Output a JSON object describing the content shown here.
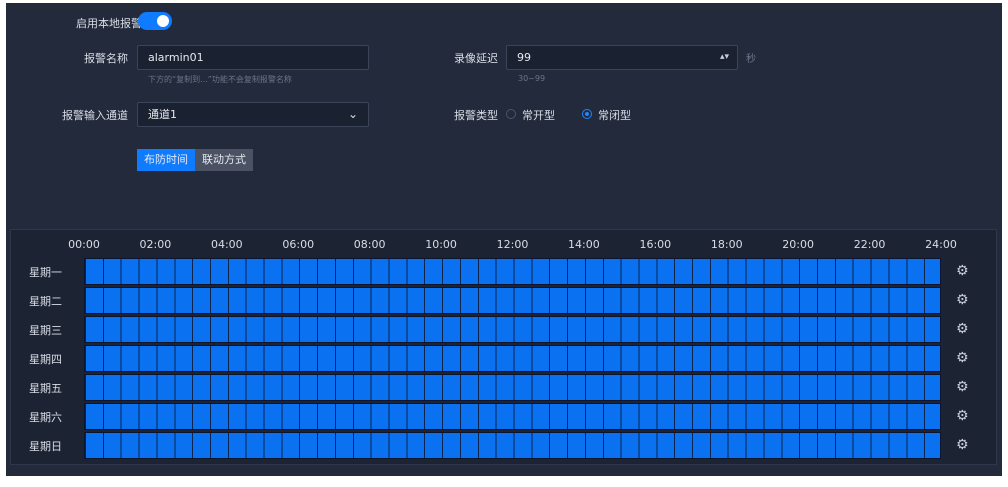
{
  "form": {
    "enable_label": "启用本地报警",
    "name_label": "报警名称",
    "name_value": "alarmin01",
    "name_hint": "下方的“复制到...”功能不会复制报警名称",
    "delay_label": "录像延迟",
    "delay_value": "99",
    "delay_unit": "秒",
    "delay_hint": "30~99",
    "input_channel_label": "报警输入通道",
    "input_channel_value": "通道1",
    "alarm_type_label": "报警类型",
    "alarm_type_options": [
      "常开型",
      "常闭型"
    ],
    "alarm_type_selected": "常闭型"
  },
  "tabs": [
    "布防时间",
    "联动方式"
  ],
  "schedule": {
    "time_labels": [
      "00:00",
      "02:00",
      "04:00",
      "06:00",
      "08:00",
      "10:00",
      "12:00",
      "14:00",
      "16:00",
      "18:00",
      "20:00",
      "22:00",
      "24:00"
    ],
    "days": [
      "星期一",
      "星期二",
      "星期三",
      "星期四",
      "星期五",
      "星期六",
      "星期日"
    ]
  },
  "colors": {
    "accent": "#0f7bff",
    "panel_bg": "#222a3b",
    "schedule_fill": "#0a72f0"
  }
}
